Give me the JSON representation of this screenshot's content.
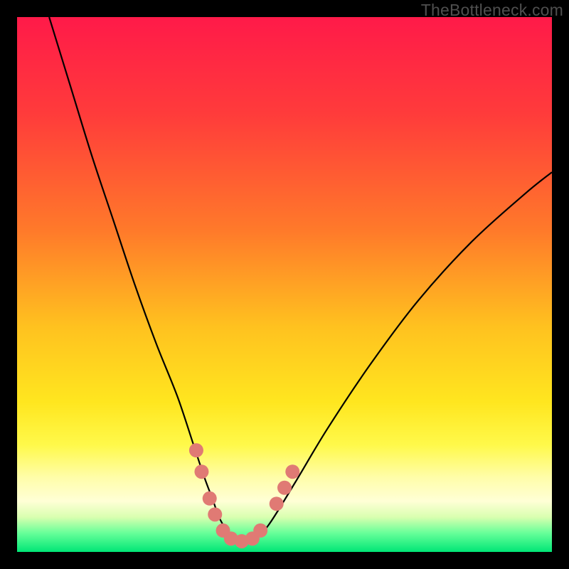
{
  "watermark": "TheBottleneck.com",
  "chart_data": {
    "type": "line",
    "title": "",
    "xlabel": "",
    "ylabel": "",
    "xlim": [
      0,
      100
    ],
    "ylim": [
      0,
      100
    ],
    "background_gradient": {
      "stops": [
        {
          "offset": 0.0,
          "color": "#ff1a49"
        },
        {
          "offset": 0.18,
          "color": "#ff3b3b"
        },
        {
          "offset": 0.4,
          "color": "#ff7a2a"
        },
        {
          "offset": 0.58,
          "color": "#ffc21f"
        },
        {
          "offset": 0.72,
          "color": "#ffe61f"
        },
        {
          "offset": 0.8,
          "color": "#fff94a"
        },
        {
          "offset": 0.86,
          "color": "#fffda8"
        },
        {
          "offset": 0.905,
          "color": "#ffffd6"
        },
        {
          "offset": 0.935,
          "color": "#d9ffb0"
        },
        {
          "offset": 0.965,
          "color": "#66ff99"
        },
        {
          "offset": 1.0,
          "color": "#00e676"
        }
      ]
    },
    "series": [
      {
        "name": "bottleneck-curve",
        "color": "#000000",
        "x": [
          6,
          10,
          14,
          18,
          22,
          26,
          30,
          33,
          35,
          36.5,
          38,
          40,
          42,
          44,
          47,
          52,
          58,
          66,
          75,
          85,
          95,
          100
        ],
        "y": [
          100,
          87,
          74,
          62,
          50,
          39,
          29,
          20,
          14,
          10,
          6,
          3,
          2,
          2,
          5,
          13,
          23,
          35,
          47,
          58,
          67,
          71
        ]
      }
    ],
    "markers": {
      "name": "highlight-dots",
      "color": "#e07a74",
      "radius": 10,
      "points": [
        {
          "x": 33.5,
          "y": 19
        },
        {
          "x": 34.5,
          "y": 15
        },
        {
          "x": 36.0,
          "y": 10
        },
        {
          "x": 37.0,
          "y": 7
        },
        {
          "x": 38.5,
          "y": 4
        },
        {
          "x": 40.0,
          "y": 2.5
        },
        {
          "x": 42.0,
          "y": 2
        },
        {
          "x": 44.0,
          "y": 2.5
        },
        {
          "x": 45.5,
          "y": 4
        },
        {
          "x": 48.5,
          "y": 9
        },
        {
          "x": 50.0,
          "y": 12
        },
        {
          "x": 51.5,
          "y": 15
        }
      ]
    }
  }
}
